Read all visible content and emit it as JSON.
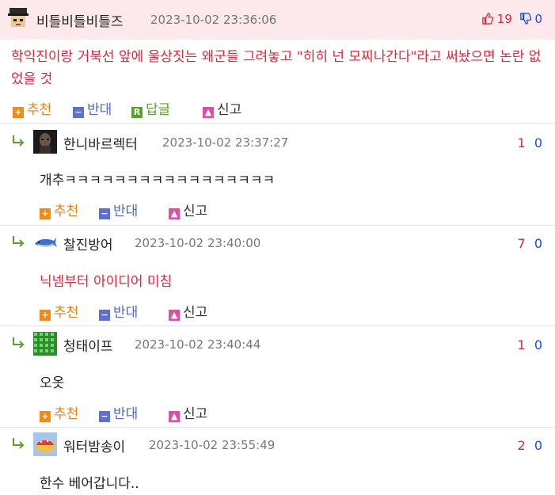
{
  "top_comment": {
    "nickname": "비틀비틀비틀즈",
    "date": "2023-10-02 23:36:06",
    "up_count": "19",
    "down_count": "0",
    "text": "학익진이랑 거북선 앞에 울상짓는 왜군들 그려놓고 \"히히 넌 모찌나간다\"라고 써놨으면 논란 없었을 것",
    "actions": {
      "recommend": "추천",
      "oppose": "반대",
      "reply": "답글",
      "report": "신고"
    }
  },
  "replies": [
    {
      "nickname": "한니바르렉터",
      "date": "2023-10-02 23:37:27",
      "up": "1",
      "down": "0",
      "text": "개추ㅋㅋㅋㅋㅋㅋㅋㅋㅋㅋㅋㅋㅋㅋㅋㅋㅋ"
    },
    {
      "nickname": "찰진방어",
      "date": "2023-10-02 23:40:00",
      "up": "7",
      "down": "0",
      "text": "닉넴부터 아이디어 미침"
    },
    {
      "nickname": "청태이프",
      "date": "2023-10-02 23:40:44",
      "up": "1",
      "down": "0",
      "text": "오옷"
    },
    {
      "nickname": "워터밤송이",
      "date": "2023-10-02 23:55:49",
      "up": "2",
      "down": "0",
      "text": "한수 베어갑니다.."
    }
  ],
  "reply_actions": {
    "recommend": "추천",
    "oppose": "반대",
    "report": "신고"
  },
  "colors": {
    "header_bg": "#fde8ec",
    "red_text": "#e0263a",
    "blue_text": "#1f48e6",
    "recommend": "#e8801e",
    "oppose": "#5668c8",
    "reply": "#5aa02c"
  },
  "icons": [
    "thumbs-up-icon",
    "thumbs-down-icon",
    "plus-icon",
    "minus-icon",
    "reply-icon",
    "report-icon",
    "reply-arrow-icon"
  ]
}
